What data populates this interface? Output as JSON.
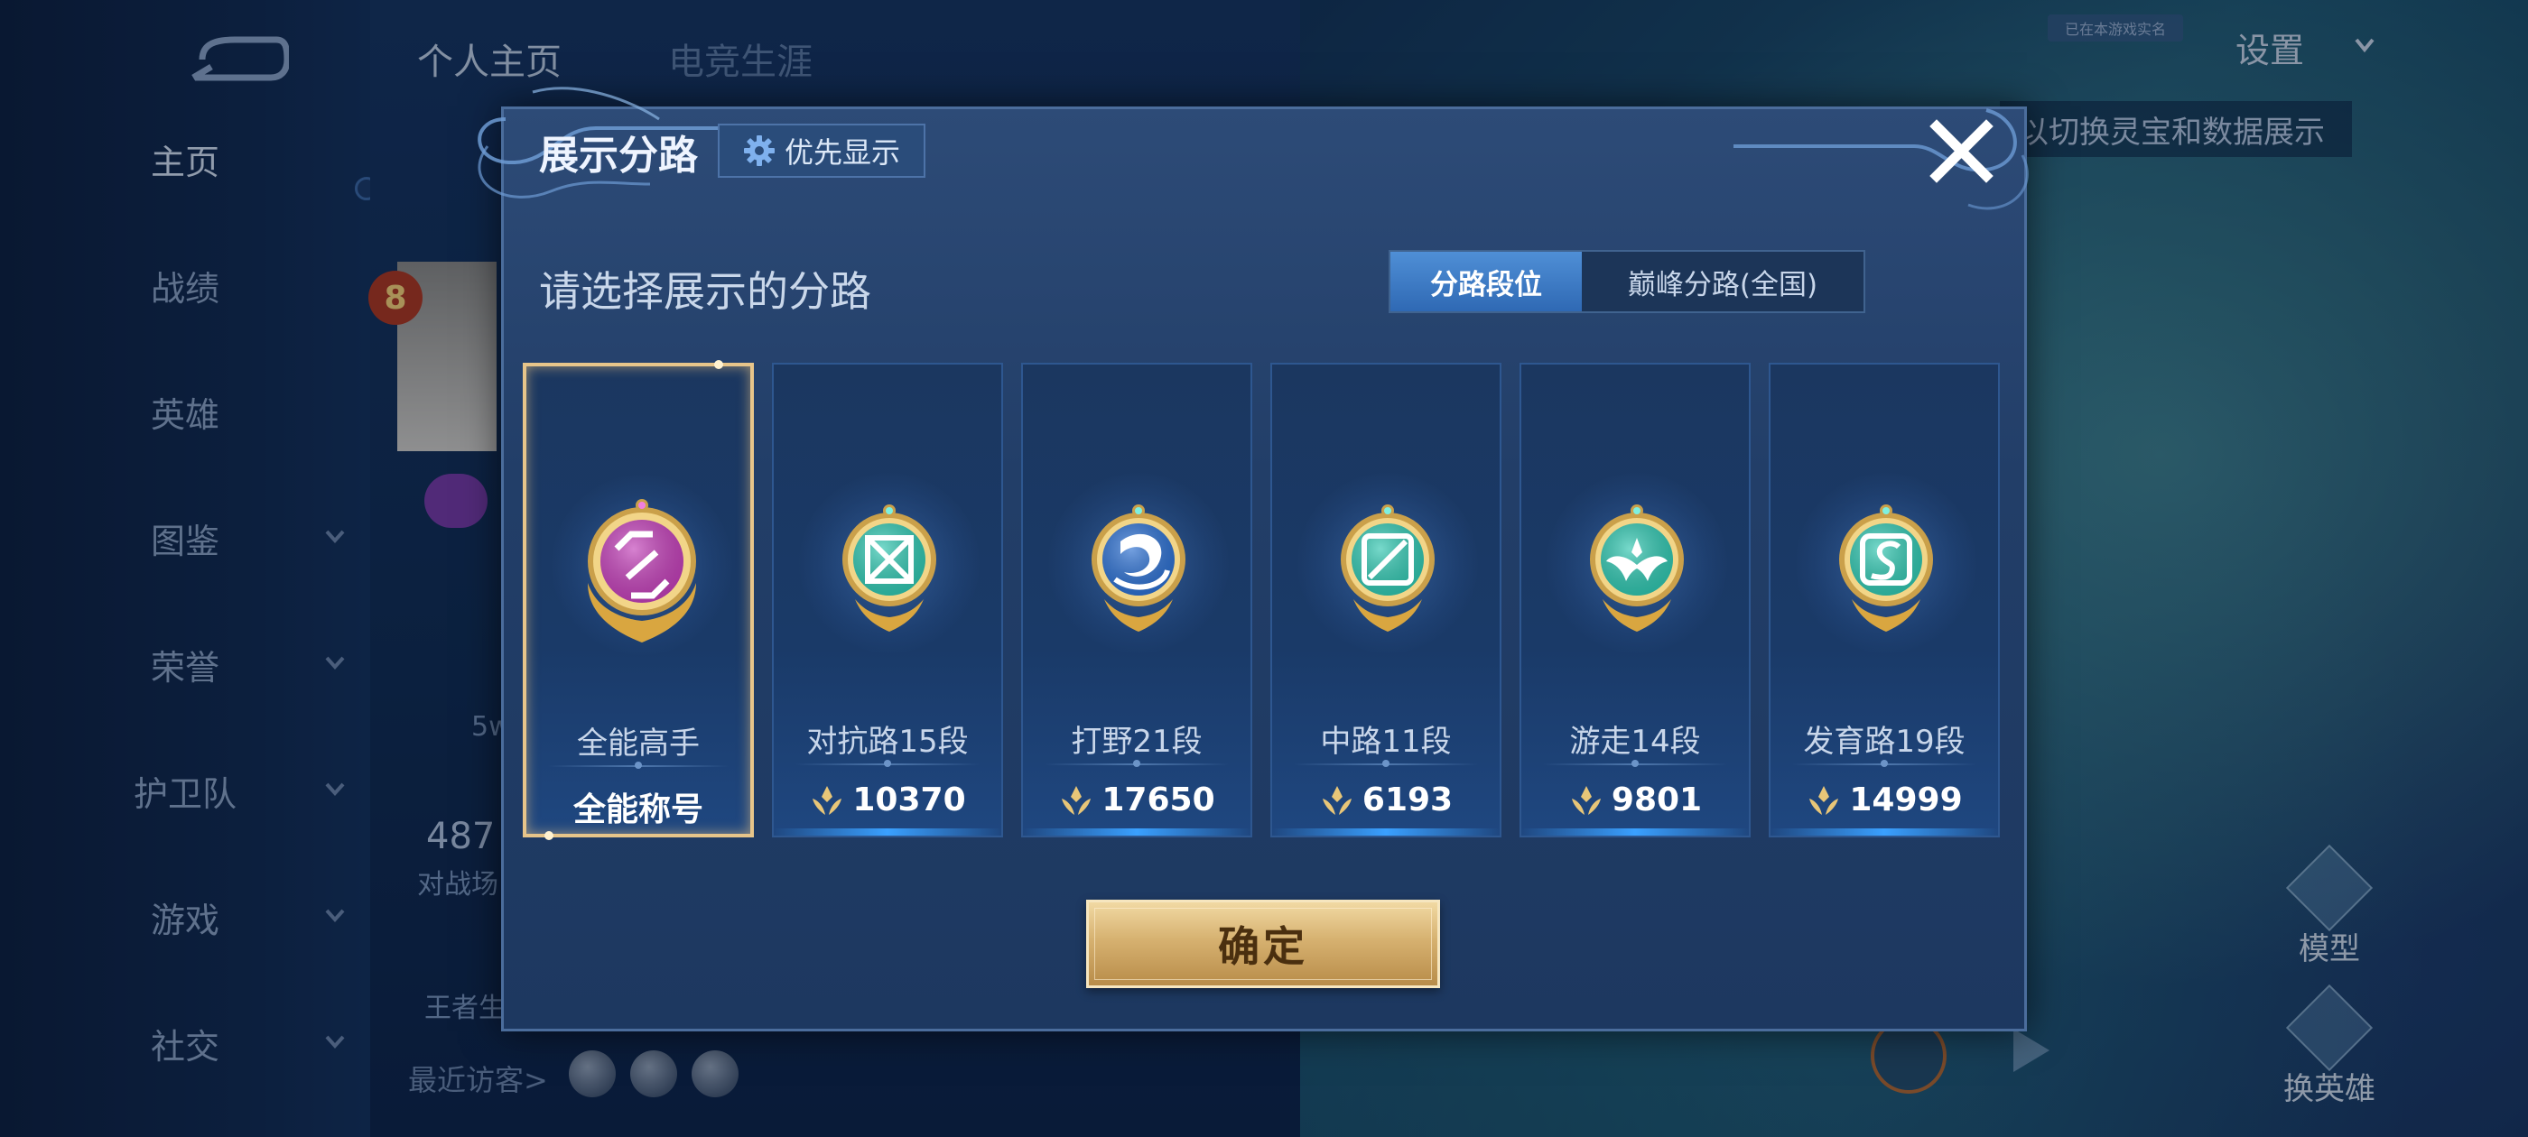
{
  "background": {
    "top_tabs": [
      "个人主页",
      "电竞生涯"
    ],
    "nav": [
      {
        "label": "主页",
        "active": true,
        "expandable": false
      },
      {
        "label": "战绩",
        "active": false,
        "expandable": false
      },
      {
        "label": "英雄",
        "active": false,
        "expandable": false
      },
      {
        "label": "图鉴",
        "active": false,
        "expandable": true
      },
      {
        "label": "荣誉",
        "active": false,
        "expandable": true
      },
      {
        "label": "护卫队",
        "active": false,
        "expandable": true
      },
      {
        "label": "游戏",
        "active": false,
        "expandable": true
      },
      {
        "label": "社交",
        "active": false,
        "expandable": true
      }
    ],
    "level": "8",
    "partial_texts": {
      "mid_5w": "5w",
      "stat_number": "487",
      "stat_caption": "对战场",
      "king_label": "王者生"
    },
    "recent_visitors_label": "最近访客>",
    "settings_label": "设置",
    "art_tag": "已在本游戏实名",
    "hint": "以切换灵宝和数据展示",
    "side_actions": [
      "模型",
      "换英雄"
    ]
  },
  "dialog": {
    "title": "展示分路",
    "priority_button": "优先显示",
    "subtitle": "请选择展示的分路",
    "tabs": [
      {
        "label": "分路段位",
        "active": true
      },
      {
        "label": "巅峰分路(全国)",
        "active": false
      }
    ],
    "cards": [
      {
        "rank": "全能高手",
        "bottom": "全能称号",
        "has_score_icon": false,
        "selected": true,
        "medal": "purple-allround-medal",
        "color": "#c23fb8"
      },
      {
        "rank": "对抗路15段",
        "bottom": "10370",
        "has_score_icon": true,
        "selected": false,
        "medal": "clash-lane-medal",
        "color": "#2fc6b0"
      },
      {
        "rank": "打野21段",
        "bottom": "17650",
        "has_score_icon": true,
        "selected": false,
        "medal": "jungle-dragon-medal",
        "color": "#2b6fd1"
      },
      {
        "rank": "中路11段",
        "bottom": "6193",
        "has_score_icon": true,
        "selected": false,
        "medal": "mid-lane-medal",
        "color": "#2fc6b0"
      },
      {
        "rank": "游走14段",
        "bottom": "9801",
        "has_score_icon": true,
        "selected": false,
        "medal": "roam-wings-medal",
        "color": "#2fc6b0"
      },
      {
        "rank": "发育路19段",
        "bottom": "14999",
        "has_score_icon": true,
        "selected": false,
        "medal": "farm-lane-medal",
        "color": "#2fc6b0"
      }
    ],
    "confirm": "确定"
  }
}
